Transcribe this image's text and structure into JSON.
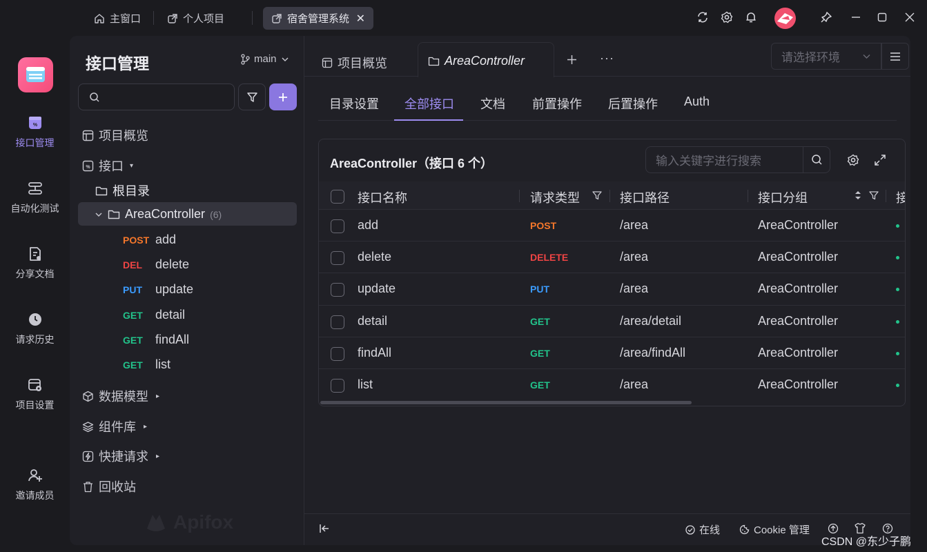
{
  "window": {
    "tabs": [
      {
        "label": "主窗口",
        "icon": "home-icon"
      },
      {
        "label": "个人项目",
        "icon": "external-link-icon"
      },
      {
        "label": "宿舍管理系统",
        "icon": "external-link-icon"
      }
    ],
    "controls": [
      "refresh-icon",
      "settings-icon",
      "bell-icon",
      "avatar",
      "pin-icon",
      "minimize-icon",
      "maximize-icon",
      "close-icon"
    ]
  },
  "rail": {
    "items": [
      {
        "label": "接口管理",
        "icon": "api-icon",
        "active": true
      },
      {
        "label": "自动化测试",
        "icon": "automation-icon"
      },
      {
        "label": "分享文档",
        "icon": "share-doc-icon"
      },
      {
        "label": "请求历史",
        "icon": "history-icon"
      },
      {
        "label": "项目设置",
        "icon": "project-settings-icon"
      },
      {
        "label": "邀请成员",
        "icon": "invite-user-icon"
      }
    ]
  },
  "sidebar": {
    "title": "接口管理",
    "branch": "main",
    "nav": {
      "overview": "项目概览",
      "apis": "接口",
      "root": "根目录",
      "folder": "AreaController",
      "folder_count": "(6)",
      "endpoints": [
        {
          "method": "POST",
          "name": "add"
        },
        {
          "method": "DEL",
          "name": "delete"
        },
        {
          "method": "PUT",
          "name": "update"
        },
        {
          "method": "GET",
          "name": "detail"
        },
        {
          "method": "GET",
          "name": "findAll"
        },
        {
          "method": "GET",
          "name": "list"
        }
      ],
      "data_models": "数据模型",
      "components": "组件库",
      "quick_requests": "快捷请求",
      "recycle_bin": "回收站"
    },
    "watermark": "Apifox"
  },
  "main": {
    "tabs": [
      {
        "label": "项目概览"
      },
      {
        "label": "AreaController"
      }
    ],
    "env_placeholder": "请选择环境",
    "subtabs": [
      "目录设置",
      "全部接口",
      "文档",
      "前置操作",
      "后置操作",
      "Auth"
    ],
    "active_subtab": "全部接口",
    "card": {
      "title": "AreaController（接口 6 个）",
      "search_placeholder": "输入关键字进行搜索",
      "columns": [
        "接口名称",
        "请求类型",
        "接口路径",
        "接口分组",
        "接"
      ],
      "rows": [
        {
          "name": "add",
          "method": "POST",
          "path": "/area",
          "group": "AreaController"
        },
        {
          "name": "delete",
          "method": "DELETE",
          "path": "/area",
          "group": "AreaController"
        },
        {
          "name": "update",
          "method": "PUT",
          "path": "/area",
          "group": "AreaController"
        },
        {
          "name": "detail",
          "method": "GET",
          "path": "/area/detail",
          "group": "AreaController"
        },
        {
          "name": "findAll",
          "method": "GET",
          "path": "/area/findAll",
          "group": "AreaController"
        },
        {
          "name": "list",
          "method": "GET",
          "path": "/area",
          "group": "AreaController"
        }
      ]
    },
    "status": {
      "online": "在线",
      "cookie": "Cookie 管理",
      "watermark": "CSDN @东少子鹏"
    }
  }
}
